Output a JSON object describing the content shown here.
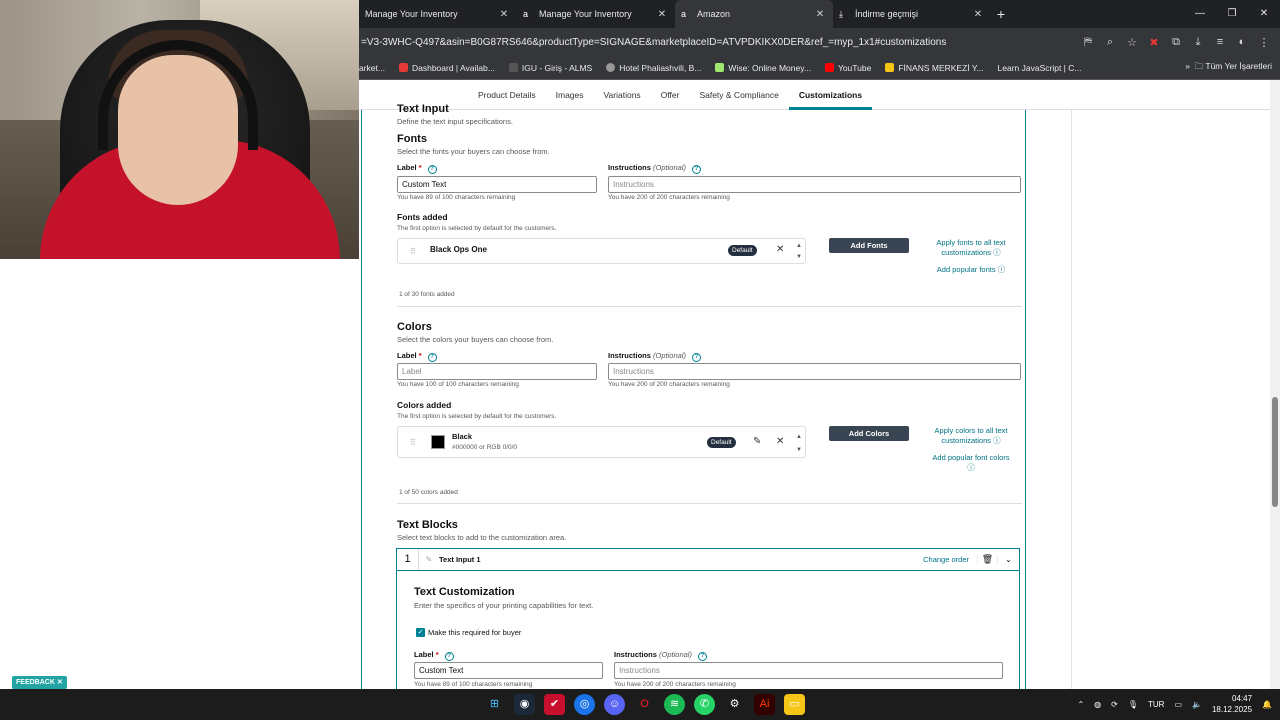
{
  "browser": {
    "tabs": [
      {
        "title": "Manage Your Inventory",
        "active": false
      },
      {
        "title": "Manage Your Inventory",
        "active": false
      },
      {
        "title": "Amazon",
        "active": true
      },
      {
        "title": "İndirme geçmişi",
        "active": false
      }
    ],
    "url": "=V3-3WHC-Q497&asin=B0G87RS646&productType=SIGNAGE&marketplaceID=ATVPDKIKX0DER&ref_=myp_1x1#customizations",
    "bookmarks": [
      "arket...",
      "Dashboard | Availab...",
      "IGU - Giriş - ALMS",
      "Hotel Phaliashvili, B...",
      "Wise: Online Money...",
      "YouTube",
      "FİNANS MERKEZİ Y...",
      "Learn JavaScript | C..."
    ],
    "bookmarks_all": "Tüm Yer İşaretleri"
  },
  "subnav": [
    "Product Details",
    "Images",
    "Variations",
    "Offer",
    "Safety & Compliance",
    "Customizations"
  ],
  "subnav_active": "Customizations",
  "text_input": {
    "title": "Text Input",
    "desc": "Define the text input specifications."
  },
  "fonts": {
    "title": "Fonts",
    "desc": "Select the fonts your buyers can choose from.",
    "label_label": "Label",
    "label_value": "Custom Text",
    "label_hint": "You have 89 of 100 characters remaining",
    "instr_label": "Instructions",
    "instr_optional": "(Optional)",
    "instr_placeholder": "Instructions",
    "instr_hint": "You have 200 of 200 characters remaining",
    "added_title": "Fonts added",
    "added_desc": "The first option is selected by default for the customers.",
    "item": "Black Ops One",
    "default_badge": "Default",
    "add_button": "Add Fonts",
    "apply_link": "Apply fonts to all text customizations",
    "popular_link": "Add popular fonts",
    "count": "1 of 30 fonts added"
  },
  "colors": {
    "title": "Colors",
    "desc": "Select the colors your buyers can choose from.",
    "label_label": "Label",
    "label_placeholder": "Label",
    "label_hint": "You have 100 of 100 characters remaining",
    "instr_label": "Instructions",
    "instr_optional": "(Optional)",
    "instr_placeholder": "Instructions",
    "instr_hint": "You have 200 of 200 characters remaining",
    "added_title": "Colors added",
    "added_desc": "The first option is selected by default for the customers.",
    "item_name": "Black",
    "item_code": "#000000 or RGB 0/0/0",
    "swatch_color": "#000000",
    "default_badge": "Default",
    "add_button": "Add Colors",
    "apply_link": "Apply colors to all text customizations",
    "popular_link": "Add popular font colors",
    "count": "1 of 50 colors added"
  },
  "text_blocks": {
    "title": "Text Blocks",
    "desc": "Select text blocks to add to the customization area.",
    "block_number": "1",
    "block_title": "Text Input 1",
    "change_order": "Change order",
    "custom_title": "Text Customization",
    "custom_desc": "Enter the specifics of your printing capabilities for text.",
    "required_label": "Make this required for buyer",
    "label_label": "Label",
    "label_value": "Custom Text",
    "label_hint": "You have 89 of 100 characters remaining",
    "instr_label": "Instructions",
    "instr_optional": "(Optional)",
    "instr_placeholder": "Instructions",
    "instr_hint": "You have 200 of 200 characters remaining"
  },
  "feedback": "FEEDBACK",
  "taskbar": {
    "lang": "TUR",
    "time": "04:47",
    "date": "18.12.2025"
  },
  "colors_theme": {
    "accent": "#008296",
    "link": "#007185",
    "badge": "#232f3e"
  }
}
